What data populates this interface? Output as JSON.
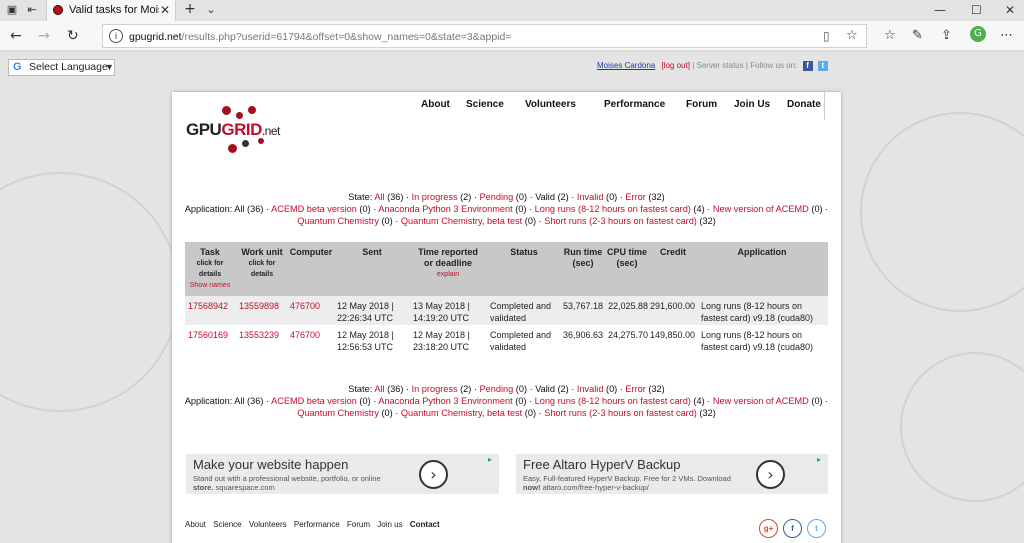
{
  "browser": {
    "tab_title": "Valid tasks for Moises C",
    "url_host": "gpugrid.net",
    "url_path": "/results.php?userid=61794&offset=0&show_names=0&state=3&appid="
  },
  "translate": {
    "label": "Select Language"
  },
  "userbar": {
    "name": "Moises Cardona",
    "logout": "[log out]",
    "server_status": "Server status",
    "follow": "Follow us on:"
  },
  "logo": {
    "gpu": "GPU",
    "grid": "GRID",
    "net": ".net"
  },
  "nav": [
    "About",
    "Science",
    "Volunteers",
    "Performance",
    "Forum",
    "Join Us",
    "Donate"
  ],
  "state_filter": {
    "label": "State:",
    "all": "All",
    "all_count": " (36) · ",
    "in_progress": "In progress",
    "in_progress_count": " (2) · ",
    "pending": "Pending",
    "pending_count": " (0) · ",
    "valid": "Valid (2)",
    "valid_sep": " · ",
    "invalid": "Invalid",
    "invalid_count": " (0) · ",
    "error": "Error",
    "error_count": " (32)"
  },
  "app_filter": {
    "label": "Application: All (36) · ",
    "a1": "ACEMD beta version",
    "a1c": " (0) · ",
    "a2": "Anaconda Python 3 Environment",
    "a2c": " (0) · ",
    "a3": "Long runs (8-12 hours on fastest card)",
    "a3c": " (4) · ",
    "a4": "New version of ACEMD",
    "a4c": " (0) · ",
    "a5": "Quantum Chemistry",
    "a5c": " (0) · ",
    "a6": "Quantum Chemistry, beta test",
    "a6c": " (0) · ",
    "a7": "Short runs (2-3 hours on fastest card)",
    "a7c": " (32)"
  },
  "table": {
    "headers": {
      "task": "Task",
      "task_sub1": "click for",
      "task_sub2": "details",
      "show_names": "Show names",
      "workunit": "Work unit",
      "wu_sub1": "click for",
      "wu_sub2": "details",
      "computer": "Computer",
      "sent": "Sent",
      "time_reported1": "Time reported",
      "time_reported2": "or deadline",
      "explain": "explain",
      "status": "Status",
      "run_time1": "Run time",
      "run_time2": "(sec)",
      "cpu_time1": "CPU time",
      "cpu_time2": "(sec)",
      "credit": "Credit",
      "application": "Application"
    },
    "rows": [
      {
        "task": "17568942",
        "workunit": "13559898",
        "computer": "476700",
        "sent1": "12 May 2018 |",
        "sent2": "22:26:34 UTC",
        "rep1": "13 May 2018 |",
        "rep2": "14:19:20 UTC",
        "status1": "Completed and",
        "status2": "validated",
        "run_time": "53,767.18",
        "cpu_time": "22,025.88",
        "credit": "291,600.00",
        "app1": "Long runs (8-12 hours on",
        "app2": "fastest card) v9.18 (cuda80)"
      },
      {
        "task": "17560169",
        "workunit": "13553239",
        "computer": "476700",
        "sent1": "12 May 2018 |",
        "sent2": "12:56:53 UTC",
        "rep1": "12 May 2018 |",
        "rep2": "23:18:20 UTC",
        "status1": "Completed and",
        "status2": "validated",
        "run_time": "36,906.63",
        "cpu_time": "24,275.70",
        "credit": "149,850.00",
        "app1": "Long runs (8-12 hours on",
        "app2": "fastest card) v9.18 (cuda80)"
      }
    ]
  },
  "ads": [
    {
      "headline": "Make your website happen",
      "line1": "Stand out with a professional website, portfolio, or online",
      "line2a": "store.",
      "line2b": " squarespace.com"
    },
    {
      "headline": "Free Altaro HyperV Backup",
      "line1": "Easy, Full-featured HyperV Backup. Free for 2 VMs. Download",
      "line2a": "now!",
      "line2b": " altaro.com/free-hyper-v-backup/"
    }
  ],
  "footer": [
    "About",
    "Science",
    "Volunteers",
    "Performance",
    "Forum",
    "Join us",
    "Contact"
  ],
  "colors": {
    "link_red": "#c20d2c",
    "header_gray": "#c8c8c8"
  }
}
